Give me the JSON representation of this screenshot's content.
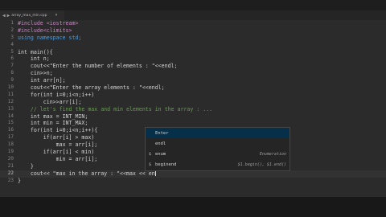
{
  "tab": {
    "filename": "array_max_min.cpp",
    "back_icon": "chevron-left-icon",
    "forward_icon": "chevron-right-icon",
    "close_icon": "close-icon"
  },
  "editor": {
    "current_line": 22,
    "line_numbers": [
      "1",
      "2",
      "3",
      "4",
      "5",
      "6",
      "7",
      "8",
      "9",
      "10",
      "11",
      "12",
      "13",
      "14",
      "15",
      "16",
      "17",
      "18",
      "19",
      "20",
      "21",
      "22",
      "23"
    ]
  },
  "code_lines": [
    "#include <iostream>",
    "#include<climits>",
    "using namespace std;",
    "",
    "int main(){",
    "    int n;",
    "    cout<<\"Enter the number of elements : \"<<endl;",
    "    cin>>n;",
    "    int arr[n];",
    "    cout<<\"Enter the array elements : \"<<endl;",
    "    for(int i=0;i<n;i++)",
    "        cin>>arr[i];",
    "    // let's find the max and min elements in the array : ...",
    "    int max = INT_MIN;",
    "    int min = INT_MAX;",
    "    for(int i=0;i<n;i++){",
    "        if(arr[i] > max)",
    "            max = arr[i];",
    "        if(arr[i] < min)",
    "            min = arr[i];",
    "    }",
    "    cout<< \"max in the array : \"<<max << en",
    "}"
  ],
  "suggestions": [
    {
      "icon": "",
      "label": "Enter",
      "detail": "",
      "selected": true
    },
    {
      "icon": "",
      "label": "endl",
      "detail": "",
      "selected": false
    },
    {
      "icon": "$",
      "label": "enum",
      "detail": "Enumeration",
      "selected": false
    },
    {
      "icon": "$",
      "label": "beginend",
      "detail": "$1.begin(), $1.end()",
      "selected": false
    }
  ],
  "colors": {
    "editor_bg": "#2b2b2b",
    "keyword": "#569cd6",
    "string": "#ce9178",
    "comment": "#6a9955",
    "selection": "#062f4a"
  }
}
